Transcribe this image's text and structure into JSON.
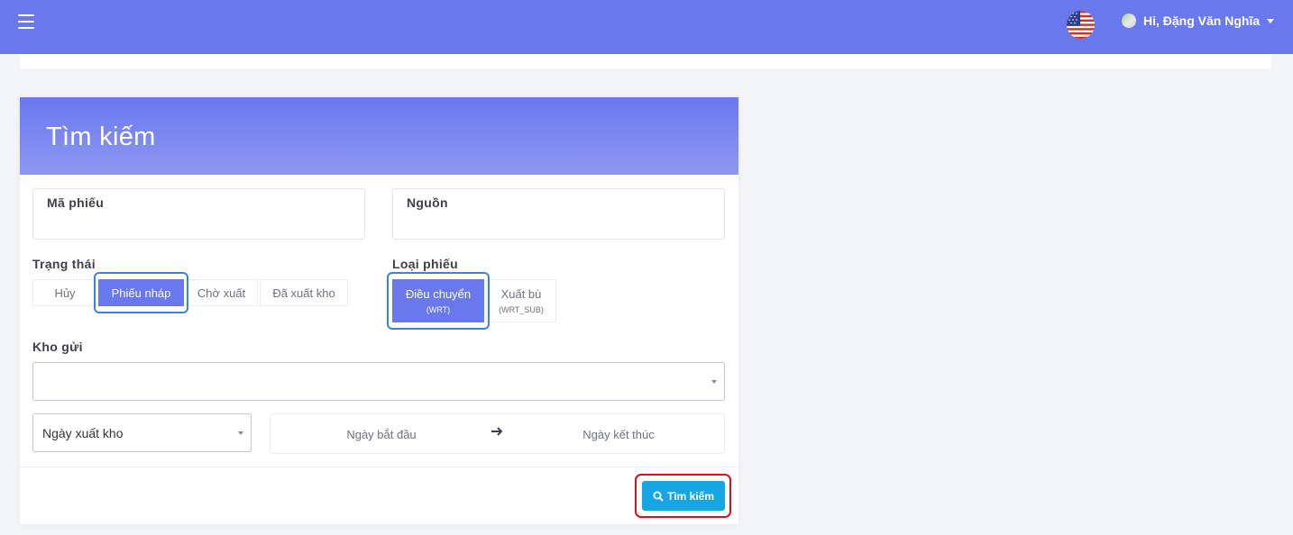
{
  "header": {
    "user_greeting": "Hi, Đặng Văn Nghĩa"
  },
  "search_card": {
    "title": "Tìm kiếm",
    "ticket_code_label": "Mã phiếu",
    "source_label": "Nguồn",
    "status": {
      "label": "Trạng thái",
      "options": [
        "Hủy",
        "Phiếu nháp",
        "Chờ xuất",
        "Đã xuất kho"
      ],
      "selected": "Phiếu nháp"
    },
    "ticket_type": {
      "label": "Loại phiếu",
      "options": [
        {
          "label": "Điều chuyển",
          "code": "(WRT)"
        },
        {
          "label": "Xuất bù",
          "code": "(WRT_SUB)"
        }
      ],
      "selected": "Điều chuyển"
    },
    "warehouse": {
      "label": "Kho gửi",
      "value": ""
    },
    "date_type": {
      "value": "Ngày xuất kho"
    },
    "date_range": {
      "start_placeholder": "Ngày bắt đầu",
      "end_placeholder": "Ngày kết thúc"
    },
    "search_button": "Tìm kiếm"
  },
  "colors": {
    "header_bg": "#6a78ee",
    "active_segment": "#6a78ee",
    "search_button": "#16a6e4",
    "highlight_ring": "#3b83d4",
    "alert_ring": "#d4141c"
  }
}
